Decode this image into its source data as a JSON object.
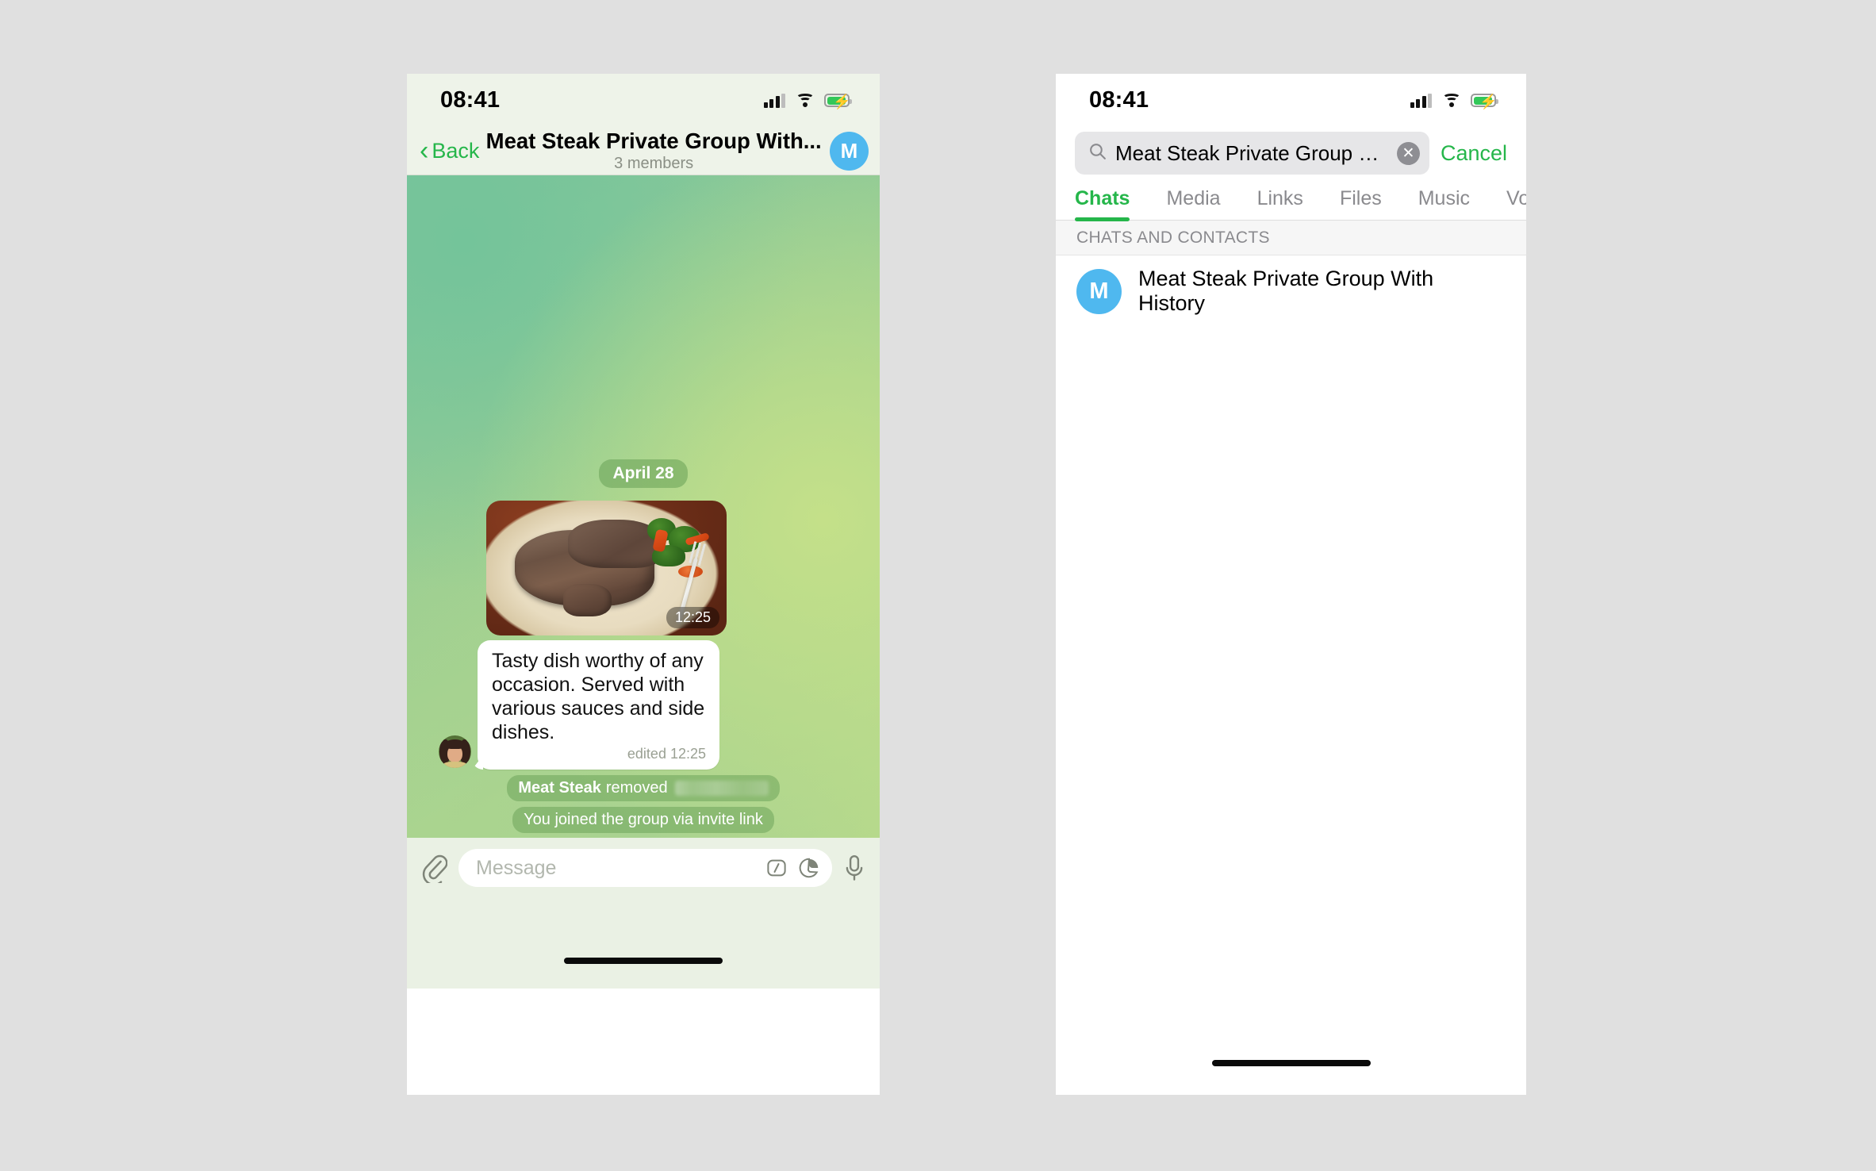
{
  "left_phone": {
    "status_bar": {
      "time": "08:41",
      "icons": [
        "signal-icon",
        "wifi-icon",
        "battery-charging-icon"
      ]
    },
    "header": {
      "back_label": "Back",
      "back_icon": "chevron-left-icon",
      "title": "Meat Steak Private Group With...",
      "subtitle": "3 members",
      "avatar_initial": "M",
      "avatar_color": "#4fb8ef"
    },
    "chat": {
      "date_separator": "April 28",
      "photo_message": {
        "time": "12:25",
        "caption_alt": "grilled steak on plate with broccoli and carrots"
      },
      "text_message": {
        "text": "Tasty dish worthy of any occasion. Served with various sauces and side dishes.",
        "meta": "edited 12:25"
      },
      "service_messages": [
        {
          "actor": "Meat Steak",
          "action": "removed",
          "target_redacted": true
        },
        {
          "text": "You joined the group via invite link"
        }
      ]
    },
    "input_bar": {
      "attach_icon": "paperclip-icon",
      "placeholder": "Message",
      "command_icon": "slash-command-icon",
      "sticker_icon": "sticker-icon",
      "voice_icon": "microphone-icon"
    }
  },
  "right_phone": {
    "status_bar": {
      "time": "08:41",
      "icons": [
        "signal-icon",
        "wifi-icon",
        "battery-charging-icon"
      ]
    },
    "search": {
      "icon": "search-icon",
      "value": "Meat Steak Private Group Wit...",
      "clear_icon": "clear-circle-icon",
      "cancel_label": "Cancel"
    },
    "tabs": [
      {
        "label": "Chats",
        "active": true
      },
      {
        "label": "Media",
        "active": false
      },
      {
        "label": "Links",
        "active": false
      },
      {
        "label": "Files",
        "active": false
      },
      {
        "label": "Music",
        "active": false
      },
      {
        "label": "Voice",
        "active": false
      }
    ],
    "section_header": "CHATS AND CONTACTS",
    "results": [
      {
        "avatar_initial": "M",
        "name": "Meat Steak Private Group With History"
      }
    ]
  },
  "colors": {
    "accent_green": "#25b64a",
    "avatar_blue": "#4fb8ef",
    "page_background": "#e0e0e0"
  }
}
